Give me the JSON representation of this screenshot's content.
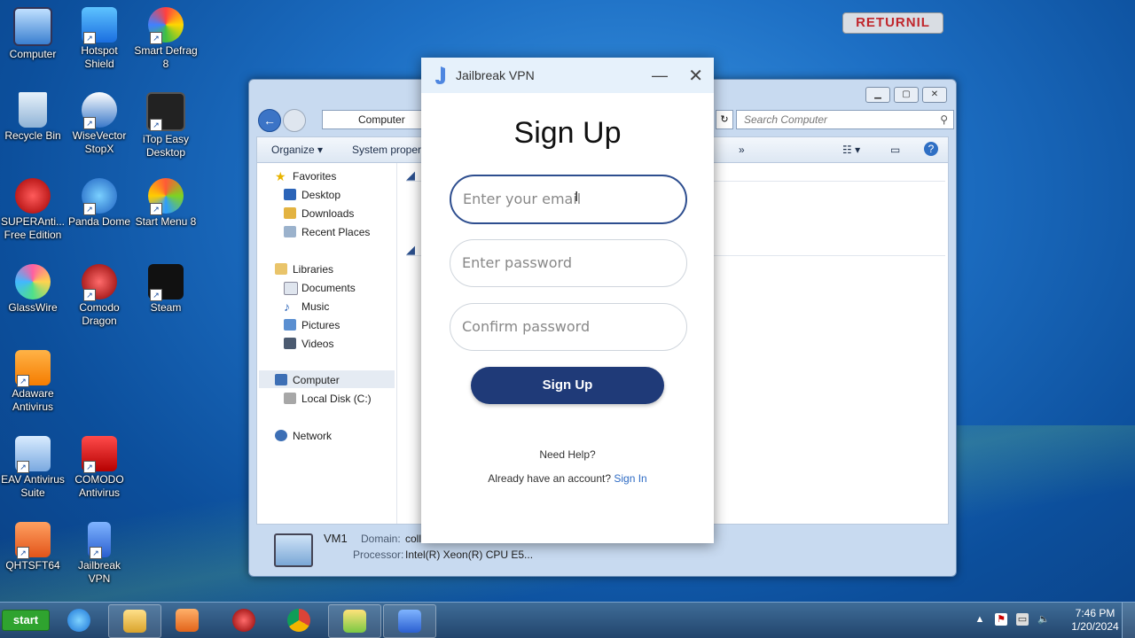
{
  "desktop": {
    "icons": [
      {
        "label": "Computer"
      },
      {
        "label": "Hotspot Shield"
      },
      {
        "label": "Smart Defrag 8"
      },
      {
        "label": "Recycle Bin"
      },
      {
        "label": "WiseVector StopX"
      },
      {
        "label": "iTop Easy Desktop"
      },
      {
        "label": "SUPERAnti... Free Edition"
      },
      {
        "label": "Panda Dome"
      },
      {
        "label": "Start Menu 8"
      },
      {
        "label": "GlassWire"
      },
      {
        "label": "Comodo Dragon"
      },
      {
        "label": "Steam"
      },
      {
        "label": "Adaware Antivirus"
      },
      {
        "label": "EAV Antivirus Suite"
      },
      {
        "label": "COMODO Antivirus"
      },
      {
        "label": "QHTSFT64"
      },
      {
        "label": "Jailbreak VPN"
      }
    ],
    "returnil_logo": "RETURNIL"
  },
  "explorer": {
    "address": "Computer",
    "search_placeholder": "Search Computer",
    "toolbar": {
      "organize": "Organize ▾",
      "system_properties": "System propert",
      "more": "»"
    },
    "nav": {
      "favorites": "Favorites",
      "desktop": "Desktop",
      "downloads": "Downloads",
      "recent_places": "Recent Places",
      "libraries": "Libraries",
      "documents": "Documents",
      "music": "Music",
      "pictures": "Pictures",
      "videos": "Videos",
      "computer": "Computer",
      "local_disk": "Local Disk (C:)",
      "network": "Network"
    },
    "details": {
      "name": "VM1",
      "domain_label": "Domain:",
      "domain_value": "coll",
      "processor_label": "Processor:",
      "processor_value": "Intel(R) Xeon(R) CPU E5..."
    }
  },
  "vpn": {
    "app_title": "Jailbreak VPN",
    "heading": "Sign Up",
    "email_placeholder": "Enter your email",
    "password_placeholder": "Enter password",
    "confirm_placeholder": "Confirm password",
    "signup_button": "Sign Up",
    "need_help": "Need Help?",
    "already_account": "Already have an account?",
    "sign_in_link": "Sign In"
  },
  "taskbar": {
    "start_label": "start",
    "time": "7:46 PM",
    "date": "1/20/2024"
  }
}
